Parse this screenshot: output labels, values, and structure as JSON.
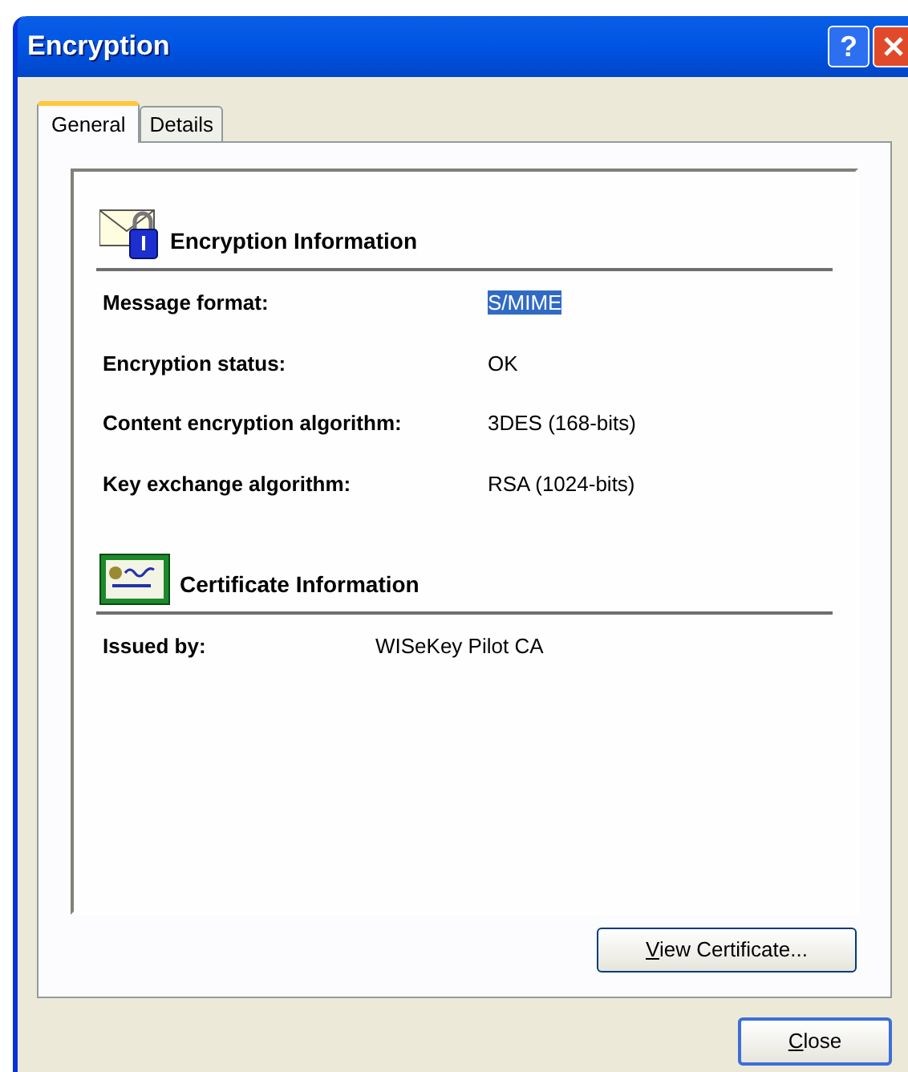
{
  "window": {
    "title": "Encryption",
    "buttons": [
      {
        "kind": "help",
        "label": "?"
      },
      {
        "kind": "close"
      }
    ]
  },
  "tabs": [
    {
      "label": "General",
      "selected": true
    },
    {
      "label": "Details",
      "selected": false
    }
  ],
  "sections": [
    {
      "kind": "encryption",
      "title": "Encryption Information",
      "rows": [
        {
          "label": "Message format:",
          "value": "S/MIME",
          "selected": true
        },
        {
          "label": "Encryption status:",
          "value": "OK",
          "selected": false
        },
        {
          "label": "Content encryption algorithm:",
          "value": "3DES (168-bits)",
          "selected": false
        },
        {
          "label": "Key exchange algorithm:",
          "value": "RSA (1024-bits)",
          "selected": false
        }
      ]
    },
    {
      "kind": "certificate",
      "title": "Certificate Information",
      "rows": [
        {
          "label": "Issued by:",
          "value": "WISeKey Pilot CA",
          "selected": false
        }
      ]
    }
  ],
  "view_button": {
    "parts": [
      {
        "text": "V",
        "underlined": true
      },
      {
        "text": "iew Certificate...",
        "underlined": false
      }
    ]
  },
  "close_button": {
    "parts": [
      {
        "text": "C",
        "underlined": true
      },
      {
        "text": "lose",
        "underlined": false
      }
    ]
  }
}
